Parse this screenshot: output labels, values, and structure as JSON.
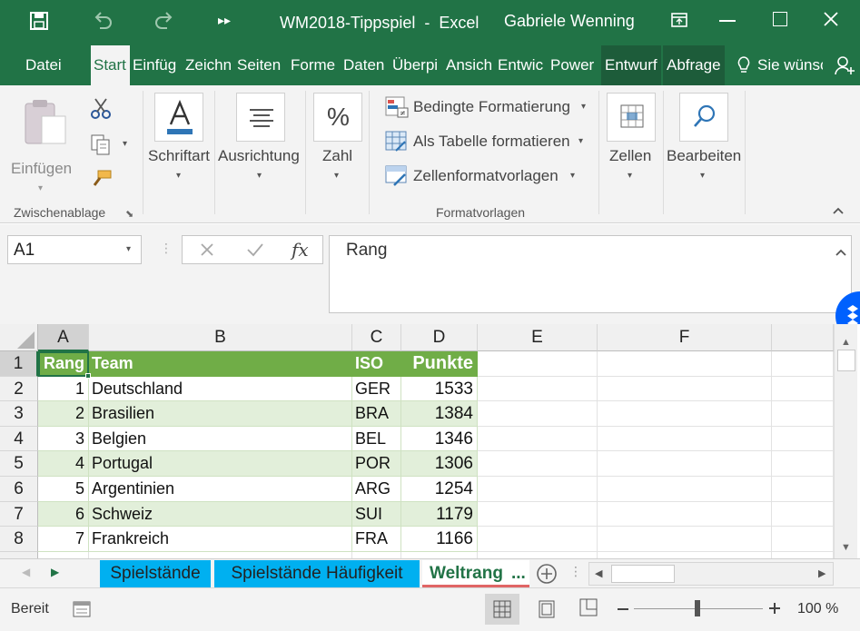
{
  "window": {
    "title": "WM2018-Tippspiel  -  Excel",
    "user": "Gabriele Wenning"
  },
  "tabs": [
    "Datei",
    "Start",
    "Einfüg",
    "Zeichn",
    "Seiten",
    "Forme",
    "Daten",
    "Überpi",
    "Ansich",
    "Entwic",
    "Power",
    "Entwurf",
    "Abfrage"
  ],
  "tell_me": "Sie wünsc",
  "ribbon": {
    "einfuegen": "Einfügen",
    "zwischenablage": "Zwischenablage",
    "schriftart": "Schriftart",
    "ausrichtung": "Ausrichtung",
    "zahl": "Zahl",
    "zahl_symbol": "%",
    "bedingte": "Bedingte Formatierung",
    "als_tabelle": "Als Tabelle formatieren",
    "zellenformatvorlagen": "Zellenformatvorlagen",
    "formatvorlagen": "Formatvorlagen",
    "zellen": "Zellen",
    "bearbeiten": "Bearbeiten"
  },
  "formula_bar": {
    "name_box": "A1",
    "fx": "fx",
    "value": "Rang"
  },
  "columns": [
    "A",
    "B",
    "C",
    "D",
    "E",
    "F"
  ],
  "rows": [
    "1",
    "2",
    "3",
    "4",
    "5",
    "6",
    "7",
    "8"
  ],
  "table": {
    "headers": [
      "Rang",
      "Team",
      "ISO",
      "Punkte"
    ],
    "data": [
      [
        "1",
        "Deutschland",
        "GER",
        "1533"
      ],
      [
        "2",
        "Brasilien",
        "BRA",
        "1384"
      ],
      [
        "3",
        "Belgien",
        "BEL",
        "1346"
      ],
      [
        "4",
        "Portugal",
        "POR",
        "1306"
      ],
      [
        "5",
        "Argentinien",
        "ARG",
        "1254"
      ],
      [
        "6",
        "Schweiz",
        "SUI",
        "1179"
      ],
      [
        "7",
        "Frankreich",
        "FRA",
        "1166"
      ]
    ]
  },
  "sheets": [
    "Spielstände",
    "Spielstände Häufigkeit",
    "Weltrang"
  ],
  "sheets_more": "...",
  "status": {
    "ready": "Bereit",
    "zoom": "100 %"
  },
  "colors": {
    "accent": "#217346",
    "table_header": "#70ad47",
    "band": "#e2efda",
    "tab_blue": "#00b0f0",
    "dropbox": "#0061fe"
  }
}
